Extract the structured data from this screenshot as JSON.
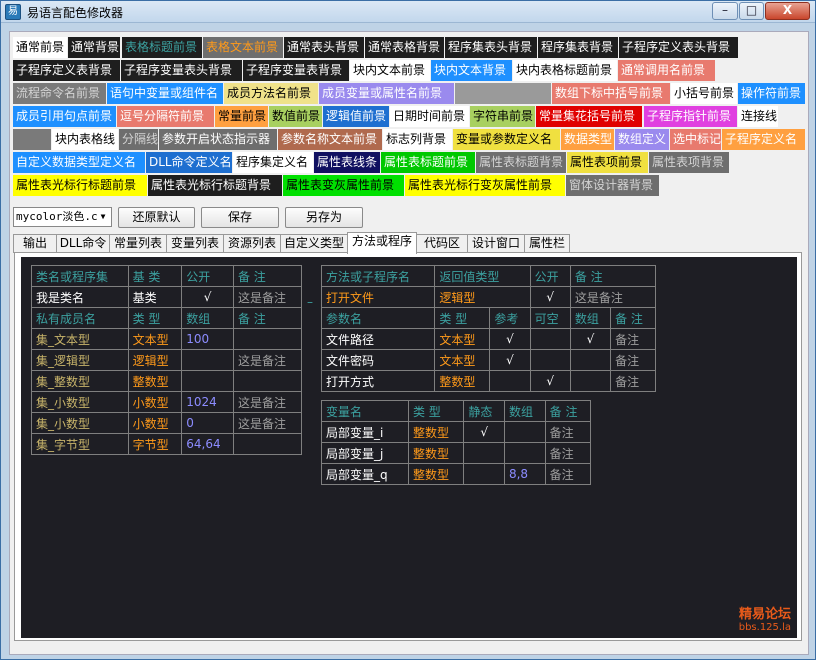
{
  "window": {
    "title": "易语言配色修改器",
    "min_label": "–",
    "max_label": "□",
    "close_label": "X"
  },
  "swatches": [
    {
      "text": "通常前景",
      "fg": "#000000",
      "bg": "#ffffff"
    },
    {
      "text": "通常背景",
      "fg": "#ffffff",
      "bg": "#1e1e1e"
    },
    {
      "text": "表格标题前景",
      "fg": "#3ca1a0",
      "bg": "#1e1e1e"
    },
    {
      "text": "表格文本前景",
      "fg": "#ff9a1a",
      "bg": "#6e6e6e"
    },
    {
      "text": "通常表头背景",
      "fg": "#ffffff",
      "bg": "#1e1e1e"
    },
    {
      "text": "通常表格背景",
      "fg": "#ffffff",
      "bg": "#1e1e1e"
    },
    {
      "text": "程序集表头背景",
      "fg": "#ffffff",
      "bg": "#1e1e1e"
    },
    {
      "text": "程序集表背景",
      "fg": "#ffffff",
      "bg": "#1e1e1e"
    },
    {
      "text": "子程序定义表头背景",
      "fg": "#ffffff",
      "bg": "#1e1e1e"
    },
    {
      "text": "子程序定义表背景",
      "fg": "#ffffff",
      "bg": "#1e1e1e"
    },
    {
      "text": "子程序变量表头背景",
      "fg": "#ffffff",
      "bg": "#1e1e1e"
    },
    {
      "text": "子程序变量表背景",
      "fg": "#ffffff",
      "bg": "#1e1e1e"
    },
    {
      "text": "块内文本前景",
      "fg": "#000000",
      "bg": "#ffffff"
    },
    {
      "text": "块内文本背景",
      "fg": "#ffffff",
      "bg": "#1e90ff"
    },
    {
      "text": "块内表格标题前景",
      "fg": "#000000",
      "bg": "#ffffff"
    },
    {
      "text": "通常调用名前景",
      "fg": "#ffffff",
      "bg": "#e87a6e"
    },
    {
      "text": "流程命令名前景",
      "fg": "#d4d4d4",
      "bg": "#7a7a7a"
    },
    {
      "text": "语句中变量或组件名",
      "fg": "#ffffff",
      "bg": "#1e90ff"
    },
    {
      "text": "成员方法名前景",
      "fg": "#000000",
      "bg": "#f0e28a"
    },
    {
      "text": "成员变量或属性名前景",
      "fg": "#ffffff",
      "bg": "#9a8aee"
    },
    {
      "text": "",
      "fg": "#ffffff",
      "bg": "#9a9a9a"
    },
    {
      "text": "数组下标中括号前景",
      "fg": "#ffffff",
      "bg": "#e87a6e"
    },
    {
      "text": "小括号前景",
      "fg": "#000000",
      "bg": "#ffffff"
    },
    {
      "text": "操作符前景",
      "fg": "#ffffff",
      "bg": "#1e90ff"
    },
    {
      "text": "成员引用句点前景",
      "fg": "#ffffff",
      "bg": "#1e90ff"
    },
    {
      "text": "逗号分隔符前景",
      "fg": "#ffffff",
      "bg": "#e87a6e"
    },
    {
      "text": "常量前景",
      "fg": "#000000",
      "bg": "#ffa040"
    },
    {
      "text": "数值前景",
      "fg": "#000000",
      "bg": "#a8d060"
    },
    {
      "text": "逻辑值前景",
      "fg": "#ffffff",
      "bg": "#1e6fd0"
    },
    {
      "text": "日期时间前景",
      "fg": "#000000",
      "bg": "#ffffff"
    },
    {
      "text": "字符串前景",
      "fg": "#000000",
      "bg": "#a8d060"
    },
    {
      "text": "常量集花括号前景",
      "fg": "#ffffff",
      "bg": "#e00000"
    },
    {
      "text": "子程序指针前景",
      "fg": "#ffffff",
      "bg": "#e040e0"
    },
    {
      "text": "连接线",
      "fg": "#000000",
      "bg": "#ffffff"
    },
    {
      "text": "",
      "fg": "#ffffff",
      "bg": "#7a7a7a"
    },
    {
      "text": "块内表格线",
      "fg": "#000000",
      "bg": "#ffffff"
    },
    {
      "text": "分隔线",
      "fg": "#d4d4d4",
      "bg": "#6e6e6e"
    },
    {
      "text": "参数开启状态指示器",
      "fg": "#ffffff",
      "bg": "#6e6e6e"
    },
    {
      "text": "参数名称文本前景",
      "fg": "#ffffff",
      "bg": "#b06a4e"
    },
    {
      "text": "标志列背景",
      "fg": "#000000",
      "bg": "#ffffff"
    },
    {
      "text": "变量或参数定义名",
      "fg": "#000000",
      "bg": "#f0e040"
    },
    {
      "text": "数据类型",
      "fg": "#ffffff",
      "bg": "#ffa040"
    },
    {
      "text": "数组定义",
      "fg": "#ffffff",
      "bg": "#9a8aee"
    },
    {
      "text": "选中标记",
      "fg": "#ffffff",
      "bg": "#e87a6e"
    },
    {
      "text": "子程序定义名",
      "fg": "#ffffff",
      "bg": "#ffa040"
    },
    {
      "text": "自定义数据类型定义名",
      "fg": "#ffffff",
      "bg": "#1e90ff"
    },
    {
      "text": "DLL命令定义名",
      "fg": "#ffffff",
      "bg": "#1e6fd0"
    },
    {
      "text": "程序集定义名",
      "fg": "#000000",
      "bg": "#ffffff"
    },
    {
      "text": "属性表线条",
      "fg": "#ffffff",
      "bg": "#101060"
    },
    {
      "text": "属性表标题前景",
      "fg": "#ffffff",
      "bg": "#00c800"
    },
    {
      "text": "属性表标题背景",
      "fg": "#d4d4d4",
      "bg": "#6e6e6e"
    },
    {
      "text": "属性表项前景",
      "fg": "#000000",
      "bg": "#f0e040"
    },
    {
      "text": "属性表项背景",
      "fg": "#d4d4d4",
      "bg": "#6e6e6e"
    },
    {
      "text": "属性表光标行标题前景",
      "fg": "#000000",
      "bg": "#ffff00"
    },
    {
      "text": "属性表光标行标题背景",
      "fg": "#ffffff",
      "bg": "#1e1e1e"
    },
    {
      "text": "属性表变灰属性前景",
      "fg": "#000000",
      "bg": "#00e000"
    },
    {
      "text": "属性表光标行变灰属性前景",
      "fg": "#000000",
      "bg": "#ffff00"
    },
    {
      "text": "窗体设计器背景",
      "fg": "#d4d4d4",
      "bg": "#6e6e6e"
    }
  ],
  "controls": {
    "combo_value": "mycolor淡色.c",
    "combo_arrow": "▼",
    "restore": "还原默认",
    "save": "保存",
    "save_as": "另存为"
  },
  "tabs": [
    "输出",
    "DLL命令",
    "常量列表",
    "变量列表",
    "资源列表",
    "自定义类型",
    "方法或程序",
    "代码区",
    "设计窗口",
    "属性栏"
  ],
  "active_tab": "方法或程序",
  "tableA": {
    "header": [
      "类名或程序集",
      "基 类",
      "公开",
      "备 注"
    ],
    "main_row": [
      "我是类名",
      "基类",
      "√",
      "这是备注"
    ],
    "sub_header": [
      "私有成员名",
      "类 型",
      "数组",
      "备 注"
    ],
    "rows": [
      [
        "集_文本型",
        "文本型",
        "100",
        ""
      ],
      [
        "集_逻辑型",
        "逻辑型",
        "",
        "这是备注"
      ],
      [
        "集_整数型",
        "整数型",
        "",
        ""
      ],
      [
        "集_小数型",
        "小数型",
        "1024",
        "这是备注"
      ],
      [
        "集_小数型",
        "小数型",
        "0",
        "这是备注"
      ],
      [
        "集_字节型",
        "字节型",
        "64,64",
        ""
      ]
    ]
  },
  "separator": "–",
  "tableB": {
    "header": [
      "方法或子程序名",
      "返回值类型",
      "公开",
      "备 注"
    ],
    "main_row": [
      "打开文件",
      "逻辑型",
      "√",
      "这是备注"
    ],
    "sub_header": [
      "参数名",
      "类 型",
      "参考",
      "可空",
      "数组",
      "备 注"
    ],
    "rows": [
      [
        "文件路径",
        "文本型",
        "√",
        "",
        "√",
        "备注"
      ],
      [
        "文件密码",
        "文本型",
        "√",
        "",
        "",
        "备注"
      ],
      [
        "打开方式",
        "整数型",
        "",
        "√",
        "",
        "备注"
      ]
    ]
  },
  "tableC": {
    "header": [
      "变量名",
      "类 型",
      "静态",
      "数组",
      "备 注"
    ],
    "rows": [
      [
        "局部变量_i",
        "整数型",
        "√",
        "",
        "备注"
      ],
      [
        "局部变量_j",
        "整数型",
        "",
        "",
        "备注"
      ],
      [
        "局部变量_q",
        "整数型",
        "",
        "8,8",
        "备注"
      ]
    ]
  },
  "watermark": {
    "line1": "精易论坛",
    "line2": "bbs.125.la"
  }
}
